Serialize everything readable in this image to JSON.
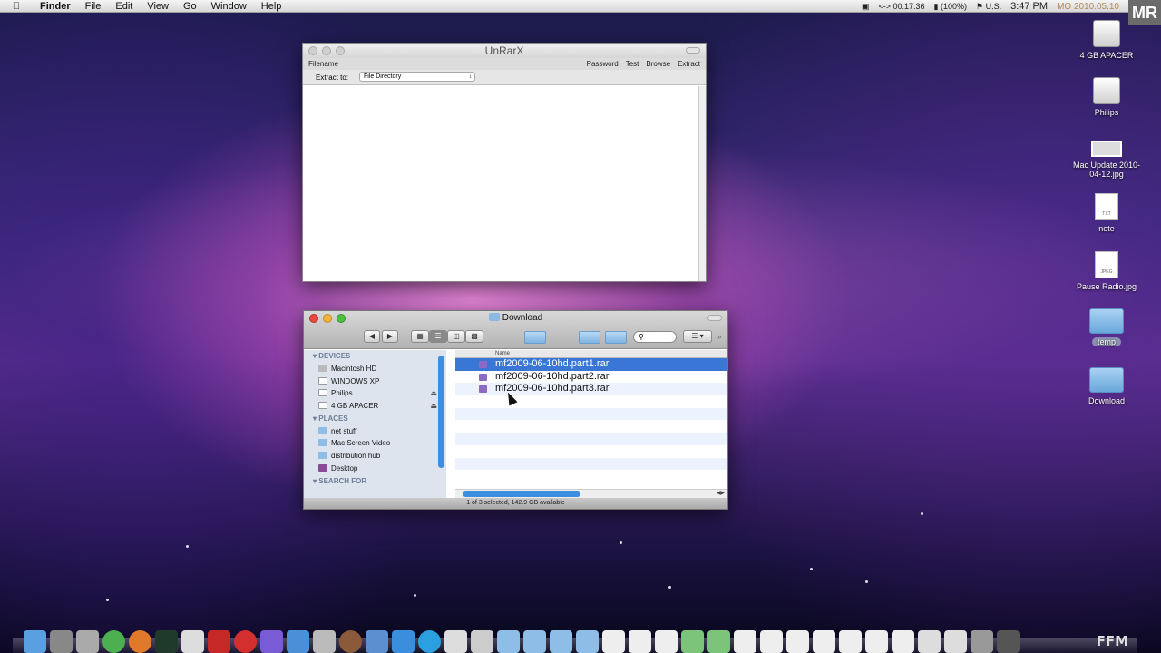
{
  "menubar": {
    "app": "Finder",
    "items": [
      "File",
      "Edit",
      "View",
      "Go",
      "Window",
      "Help"
    ],
    "timer": "00:17:36",
    "battery": "(100%)",
    "input": "U.S.",
    "time": "3:47 PM",
    "date": "MO 2010.05.10",
    "logo": "MR"
  },
  "desktop_icons": [
    {
      "label": "4 GB APACER",
      "icon": "drive-icon"
    },
    {
      "label": "Philips",
      "icon": "drive-icon"
    },
    {
      "label": "Mac Update 2010-04-12.jpg",
      "icon": "image-icon"
    },
    {
      "label": "note",
      "icon": "text-file-icon",
      "tag": "TXT"
    },
    {
      "label": "Pause Radio.jpg",
      "icon": "image-icon",
      "tag": "JPEG"
    },
    {
      "label": "temp",
      "icon": "folder-icon"
    },
    {
      "label": "Download",
      "icon": "folder-icon"
    }
  ],
  "unrarx": {
    "title": "UnRarX",
    "filename_label": "Filename",
    "actions": [
      "Password",
      "Test",
      "Browse",
      "Extract"
    ],
    "extract_to_label": "Extract to:",
    "extract_to_value": "File Directory"
  },
  "finder": {
    "title": "Download",
    "devices_header": "DEVICES",
    "devices": [
      {
        "label": "Macintosh HD",
        "eject": false
      },
      {
        "label": "WINDOWS XP",
        "eject": false
      },
      {
        "label": "Philips",
        "eject": true
      },
      {
        "label": "4 GB APACER",
        "eject": true
      }
    ],
    "places_header": "PLACES",
    "places": [
      "net stuff",
      "Mac Screen Video",
      "distribution hub",
      "Desktop"
    ],
    "search_header": "SEARCH FOR",
    "column_name": "Name",
    "files": [
      "mf2009-06-10hd.part1.rar",
      "mf2009-06-10hd.part2.rar",
      "mf2009-06-10hd.part3.rar"
    ],
    "status": "1 of 3 selected, 142.9 GB available"
  },
  "dock_watermark": "FFM"
}
